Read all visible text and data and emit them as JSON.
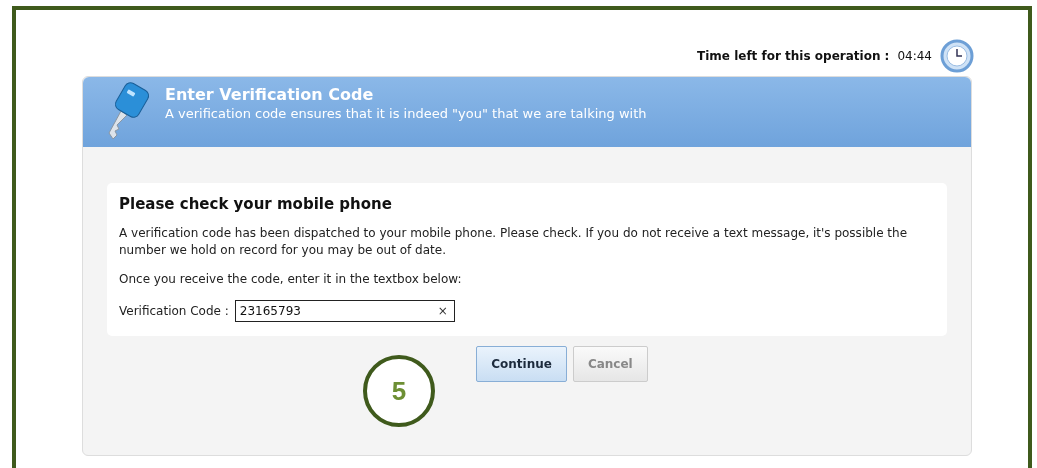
{
  "timer": {
    "label": "Time left for this operation :",
    "value": "04:44"
  },
  "header": {
    "title": "Enter Verification Code",
    "subtitle": "A verification code ensures that it is indeed \"you\" that we are talking with"
  },
  "card": {
    "heading": "Please check your mobile phone",
    "message": "A verification code has been dispatched to your mobile phone. Please check. If you do not receive a text message, it's possible the number we hold on record for you may be out of date.",
    "instruction": "Once you receive the code, enter it in the textbox below:",
    "field": {
      "label": "Verification Code :",
      "value": "23165793",
      "clear": "×"
    }
  },
  "buttons": [
    {
      "label": "Continue",
      "primary": true
    },
    {
      "label": "Cancel",
      "primary": false
    }
  ],
  "callout": {
    "label": "5"
  }
}
